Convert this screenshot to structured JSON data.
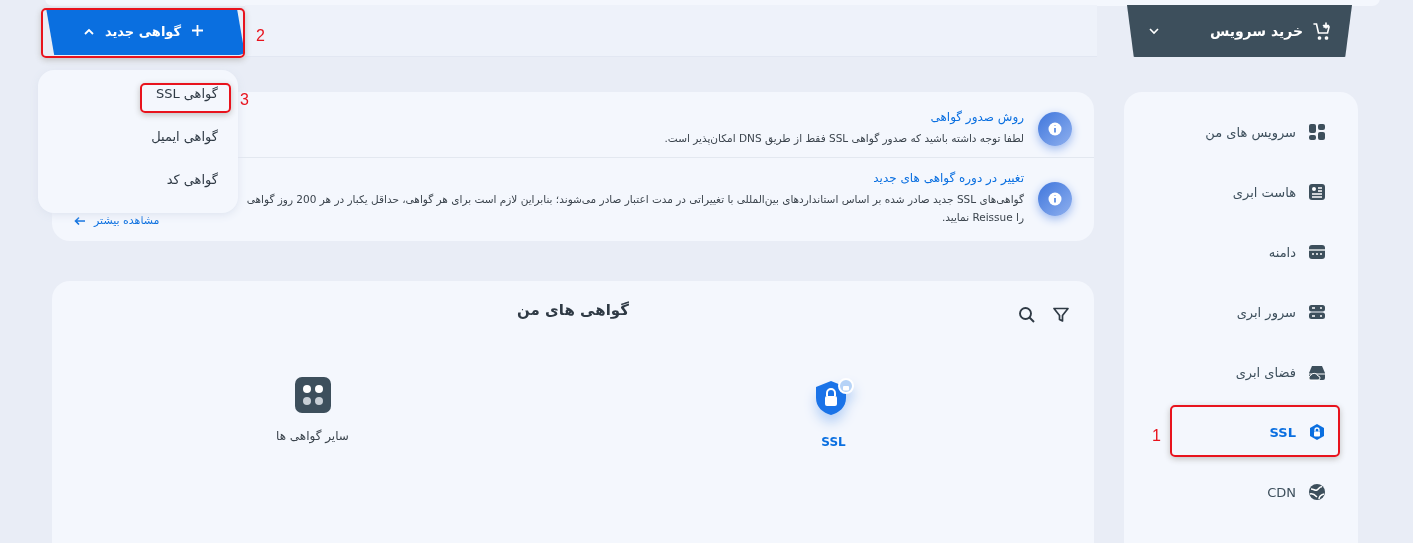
{
  "header": {
    "buy_button": {
      "label": "خرید سرویس"
    },
    "new_button": {
      "label": "گواهی جدید",
      "expanded": true
    }
  },
  "dropdown": {
    "items": [
      {
        "label": "گواهی SSL"
      },
      {
        "label": "گواهی ایمیل"
      },
      {
        "label": "گواهی کد"
      }
    ]
  },
  "sidebar": {
    "items": [
      {
        "label": "سرویس های من",
        "selected": false
      },
      {
        "label": "هاست ابری",
        "selected": false
      },
      {
        "label": "دامنه",
        "selected": false
      },
      {
        "label": "سرور ابری",
        "selected": false
      },
      {
        "label": "فضای ابری",
        "selected": false
      },
      {
        "label": "SSL",
        "selected": true
      },
      {
        "label": "CDN",
        "selected": false
      }
    ]
  },
  "notices": [
    {
      "title": "روش صدور گواهی",
      "text": "لطفا توجه داشته باشید که صدور گواهی SSL فقط از طریق DNS امکان‌پذیر است."
    },
    {
      "title": "تغییر در دوره گواهی های جدید",
      "text": "گواهی‌های SSL جدید صادر شده بر اساس استانداردهای بین‌المللی با تغییراتی در مدت اعتبار صادر می‌شوند؛ بنابراین لازم است برای هر گواهی، حداقل یکبار در هر 200 روز گواهی را Reissue نمایید.",
      "link": "مشاهده بیشتر"
    }
  ],
  "certificates": {
    "title": "گواهی های من",
    "tiles": [
      {
        "label": "SSL",
        "kind": "ssl",
        "selected": true
      },
      {
        "label": "سایر گواهی ها",
        "kind": "other",
        "selected": false
      }
    ]
  },
  "annotations": [
    {
      "number": "1"
    },
    {
      "number": "2"
    },
    {
      "number": "3"
    }
  ]
}
